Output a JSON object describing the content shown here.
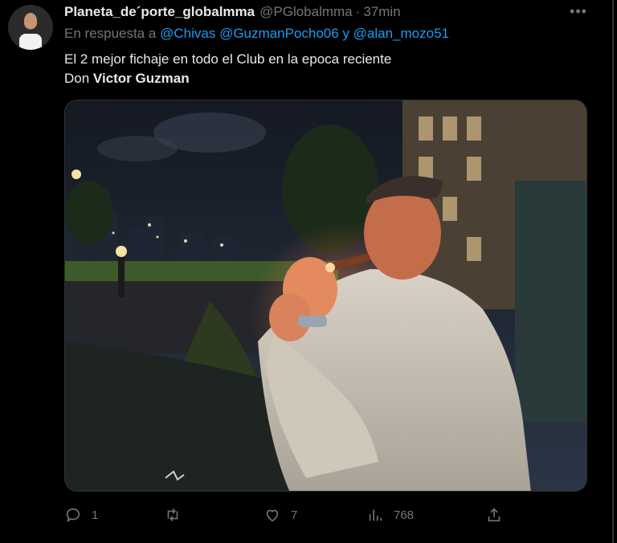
{
  "tweet": {
    "author": {
      "display_name": "Planeta_de´porte_globalmma",
      "handle": "@PGlobalmma",
      "separator": "·",
      "time": "37min"
    },
    "reply_to": {
      "prefix": "En respuesta a",
      "mention_1": "@Chivas",
      "mention_2": "@GuzmanPocho06",
      "conjunction": "y",
      "mention_3": "@alan_mozo51"
    },
    "text": {
      "line_1": "El 2 mejor fichaje en todo el Club en la epoca reciente",
      "line_2_prefix": "Don",
      "line_2_bold": "Victor Guzman"
    },
    "more_icon": "more-horizontal-icon",
    "actions": {
      "reply": {
        "icon": "reply-icon",
        "count": "1"
      },
      "retweet": {
        "icon": "retweet-icon",
        "count": ""
      },
      "like": {
        "icon": "heart-icon",
        "count": "7"
      },
      "views": {
        "icon": "views-chart-icon",
        "count": "768"
      },
      "share": {
        "icon": "share-icon",
        "count": ""
      }
    },
    "colors": {
      "background": "#000000",
      "primary_text": "#e7e9ea",
      "secondary_text": "#71767b",
      "link": "#1d9bf0",
      "border": "#2f3336"
    }
  }
}
